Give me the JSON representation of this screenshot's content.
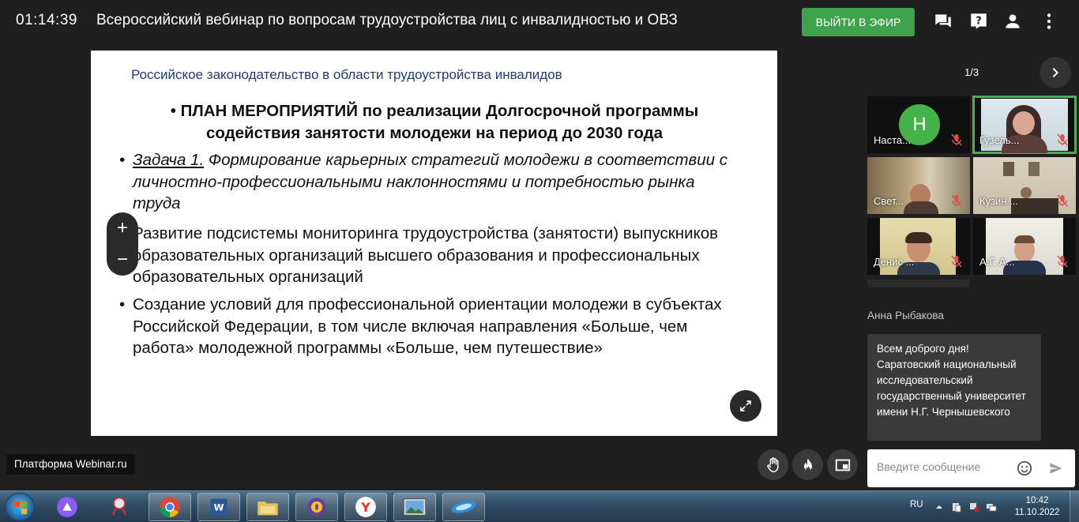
{
  "header": {
    "timer": "01:14:39",
    "title": "Всероссийский вебинар по вопросам трудоустройства лиц с инвалидностью и ОВЗ",
    "live_button": "ВЫЙТИ В ЭФИР",
    "icons": [
      "chat-icon",
      "help-icon",
      "user-icon",
      "more-vert-icon"
    ]
  },
  "slide": {
    "heading": "Российское законодательство  в области трудоустройства  инвалидов",
    "plan": "ПЛАН МЕРОПРИЯТИЙ по реализации Долгосрочной программы содействия занятости  молодежи на период до 2030 года",
    "bullet_mark": "•",
    "task_label": "Задача 1.",
    "task_text": " Формирование карьерных стратегий молодежи в соответствии с личностно-профессиональными  наклонностями и потребностью рынка труда",
    "item2": "Развитие подсистемы мониторинга трудоустройства (занятости) выпускников образовательных организаций высшего образования и профессиональных образовательных организаций",
    "item3": "Создание условий для профессиональной ориентации молодежи в субъектах Российской Федерации, в том числе включая направления «Больше, чем работа» молодежной программы «Больше, чем путешествие»"
  },
  "zoom": {
    "plus": "+",
    "minus": "−"
  },
  "platform_label": "Платформа Webinar.ru",
  "controls": [
    "raise-hand-icon",
    "fire-icon",
    "picture-in-picture-icon"
  ],
  "participants": {
    "page_indicator": "1/3",
    "tiles": [
      {
        "name": "Наста...",
        "initial": "Н",
        "active": false
      },
      {
        "name": "Гузель...",
        "active": true
      },
      {
        "name": "Свет...",
        "active": false
      },
      {
        "name": "Кузин ...",
        "active": false
      },
      {
        "name": "Денис ...",
        "active": false
      },
      {
        "name": "А.Г. А...",
        "active": false
      }
    ]
  },
  "chat": {
    "author": "Анна Рыбакова",
    "message": "Всем доброго дня! Саратовский национальный исследовательский государственный университет имени Н.Г. Чернышевского",
    "input_placeholder": "Введите сообщение"
  },
  "taskbar": {
    "apps": [
      "alice-icon",
      "snipping-tool-icon",
      "chrome-icon",
      "word-icon",
      "file-manager-icon",
      "vpn-icon",
      "yandex-browser-icon",
      "photo-viewer-icon",
      "webinar-app-icon"
    ],
    "language": "RU",
    "time": "10:42",
    "date": "11.10.2022"
  },
  "colors": {
    "accent_green": "#3fa34d",
    "slide_heading_blue": "#1f3a78",
    "active_tile_outline": "#4cae5a"
  }
}
